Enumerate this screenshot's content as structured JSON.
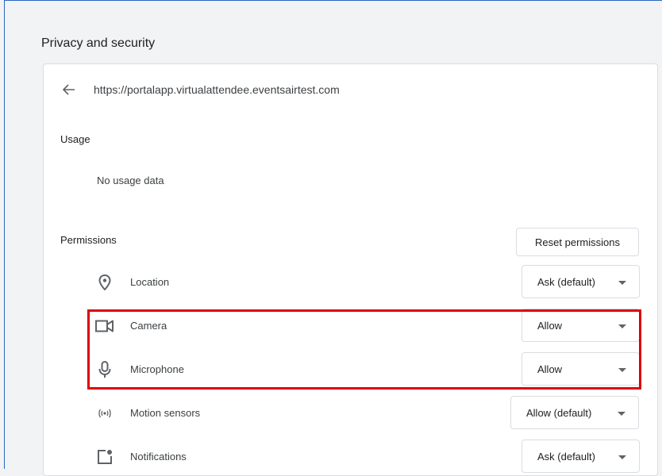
{
  "page": {
    "section_title": "Privacy and security",
    "site_url": "https://portalapp.virtualattendee.eventsairtest.com"
  },
  "usage": {
    "heading": "Usage",
    "value": "No usage data"
  },
  "permissions": {
    "heading": "Permissions",
    "reset_label": "Reset permissions",
    "items": [
      {
        "label": "Location",
        "value": "Ask (default)",
        "icon": "location-pin-icon"
      },
      {
        "label": "Camera",
        "value": "Allow",
        "icon": "camera-icon"
      },
      {
        "label": "Microphone",
        "value": "Allow",
        "icon": "microphone-icon"
      },
      {
        "label": "Motion sensors",
        "value": "Allow (default)",
        "icon": "motion-sensor-icon"
      },
      {
        "label": "Notifications",
        "value": "Ask (default)",
        "icon": "notification-icon"
      }
    ]
  },
  "colors": {
    "highlight": "#e00000",
    "frame_border": "#2d67c0",
    "icon": "#5f6368"
  }
}
